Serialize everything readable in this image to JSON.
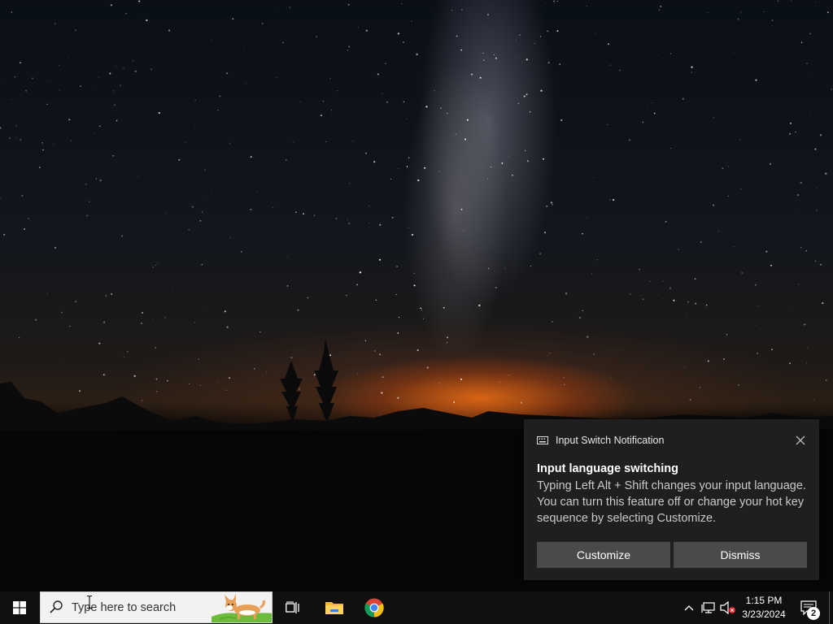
{
  "desktop": {
    "wallpaper": "night-sky-milky-way"
  },
  "toast": {
    "app_name": "Input Switch Notification",
    "app_icon": "keyboard-icon",
    "title": "Input language switching",
    "body": "Typing Left Alt + Shift changes your input language. You can turn this feature off or change your hot key sequence by selecting Customize.",
    "buttons": {
      "customize": "Customize",
      "dismiss": "Dismiss"
    },
    "close_icon": "close-icon"
  },
  "taskbar": {
    "search": {
      "placeholder": "Type here to search"
    },
    "pinned": [
      "task-view-icon",
      "file-explorer-icon",
      "chrome-icon"
    ],
    "tray": {
      "time": "1:15 PM",
      "date": "3/23/2024",
      "notification_count": "2"
    }
  },
  "colors": {
    "taskbar_bg": "#101010",
    "toast_bg": "#1f1f1f",
    "toast_button_bg": "#4a4a4a",
    "search_bg": "#f2f2f2"
  }
}
